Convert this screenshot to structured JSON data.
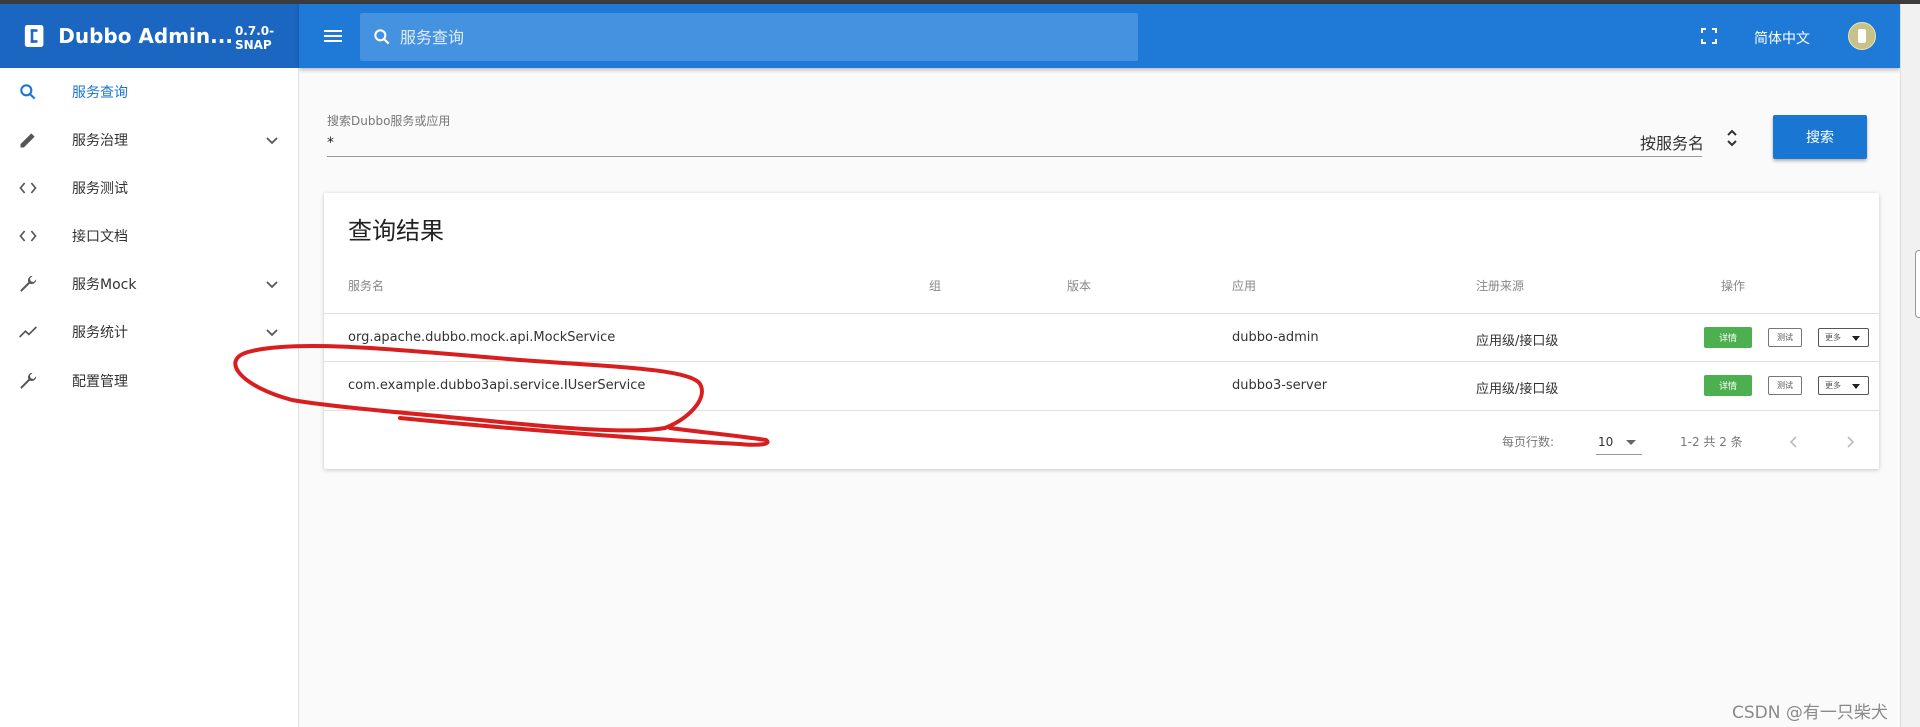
{
  "app": {
    "title": "Dubbo Admin...",
    "version": "0.7.0-SNAP",
    "search_placeholder": "服务查询",
    "language": "简体中文"
  },
  "sidebar": {
    "items": [
      {
        "label": "服务查询",
        "icon": "search-icon",
        "active": true,
        "expandable": false
      },
      {
        "label": "服务治理",
        "icon": "pencil-icon",
        "active": false,
        "expandable": true
      },
      {
        "label": "服务测试",
        "icon": "code-icon",
        "active": false,
        "expandable": false
      },
      {
        "label": "接口文档",
        "icon": "code-icon",
        "active": false,
        "expandable": false
      },
      {
        "label": "服务Mock",
        "icon": "wrench-icon",
        "active": false,
        "expandable": true
      },
      {
        "label": "服务统计",
        "icon": "trending-icon",
        "active": false,
        "expandable": true
      },
      {
        "label": "配置管理",
        "icon": "wrench-icon",
        "active": false,
        "expandable": false
      }
    ]
  },
  "search": {
    "label": "搜索Dubbo服务或应用",
    "value": "*",
    "type_select": "按服务名",
    "button": "搜索"
  },
  "results": {
    "title": "查询结果",
    "columns": [
      "服务名",
      "组",
      "版本",
      "应用",
      "注册来源",
      "操作"
    ],
    "rows": [
      {
        "service": "org.apache.dubbo.mock.api.MockService",
        "group": "",
        "version": "",
        "app": "dubbo-admin",
        "source": "应用级/接口级"
      },
      {
        "service": "com.example.dubbo3api.service.IUserService",
        "group": "",
        "version": "",
        "app": "dubbo3-server",
        "source": "应用级/接口级"
      }
    ],
    "actions": {
      "detail": "详情",
      "test": "测试",
      "more": "更多"
    },
    "footer": {
      "rows_per_page_label": "每页行数:",
      "rows_per_page": "10",
      "range": "1-2 共 2 条"
    }
  },
  "colors": {
    "brand": "#1b66c0",
    "topbar": "#1e7ad6",
    "primary": "#1976d2",
    "detail_button": "#4caf50",
    "annotation": "#d81e1e"
  },
  "watermark": "CSDN @有一只柴犬"
}
